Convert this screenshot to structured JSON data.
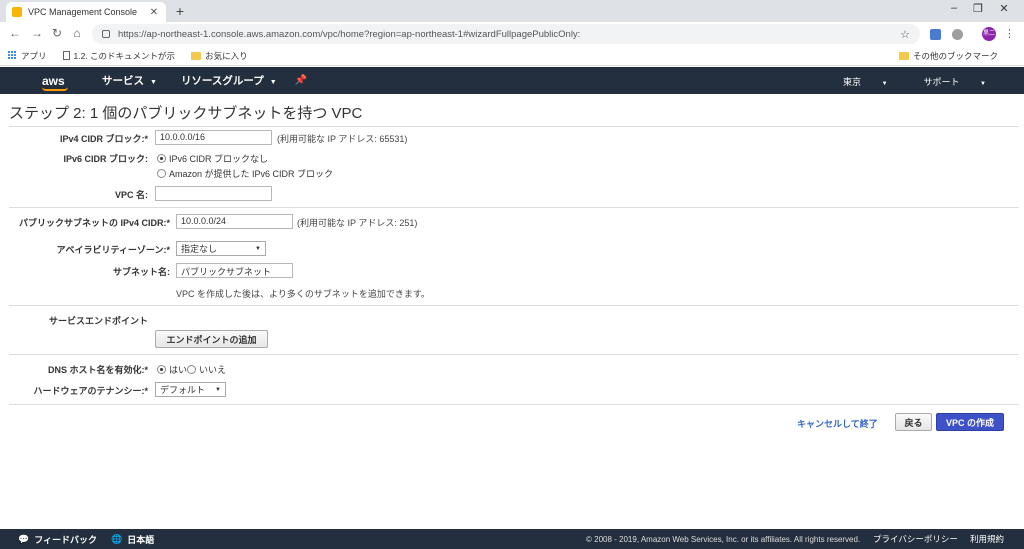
{
  "browser": {
    "tab_title": "VPC Management Console",
    "url": "https://ap-northeast-1.console.aws.amazon.com/vpc/home?region=ap-northeast-1#wizardFullpagePublicOnly:",
    "bookmarks": [
      "アプリ",
      "1.2. このドキュメントが示",
      "お気に入り"
    ],
    "other_bookmarks": "その他のブックマーク",
    "avatar_text": "黒二"
  },
  "aws_nav": {
    "logo": "aws",
    "services": "サービス",
    "resource_groups": "リソースグループ",
    "region": "東京",
    "support": "サポート"
  },
  "page": {
    "title": "ステップ 2: 1 個のパブリックサブネットを持つ VPC",
    "ipv4_label": "IPv4 CIDR ブロック:*",
    "ipv4_value": "10.0.0.0/16",
    "ipv4_info": "(利用可能な IP アドレス: 65531)",
    "ipv6_label": "IPv6 CIDR ブロック:",
    "ipv6_option_none": "IPv6 CIDR ブロックなし",
    "ipv6_option_amazon": "Amazon が提供した IPv6 CIDR ブロック",
    "vpc_name_label": "VPC 名:",
    "vpc_name_value": "",
    "subnet_cidr_label": "パブリックサブネットの IPv4 CIDR:*",
    "subnet_cidr_value": "10.0.0.0/24",
    "subnet_cidr_info": "(利用可能な IP アドレス: 251)",
    "az_label": "アベイラビリティーゾーン:*",
    "az_value": "指定なし",
    "subnet_name_label": "サブネット名:",
    "subnet_name_value": "パブリックサブネット",
    "subnet_hint": "VPC を作成した後は、より多くのサブネットを追加できます。",
    "endpoint_label": "サービスエンドポイント",
    "endpoint_button": "エンドポイントの追加",
    "dns_label": "DNS ホスト名を有効化:*",
    "dns_yes": "はい",
    "dns_no": "いいえ",
    "tenancy_label": "ハードウェアのテナンシー:*",
    "tenancy_value": "デフォルト",
    "cancel_link": "キャンセルして終了",
    "back_button": "戻る",
    "create_button": "VPC の作成"
  },
  "footer": {
    "feedback": "フィードバック",
    "language": "日本語",
    "copyright": "© 2008 - 2019, Amazon Web Services, Inc. or its affiliates. All rights reserved.",
    "privacy": "プライバシーポリシー",
    "terms": "利用規約"
  },
  "colors": {
    "aws_nav_bg": "#232f3e",
    "aws_orange": "#ff9900",
    "primary_button": "#3f51c7",
    "link": "#3366cc"
  }
}
